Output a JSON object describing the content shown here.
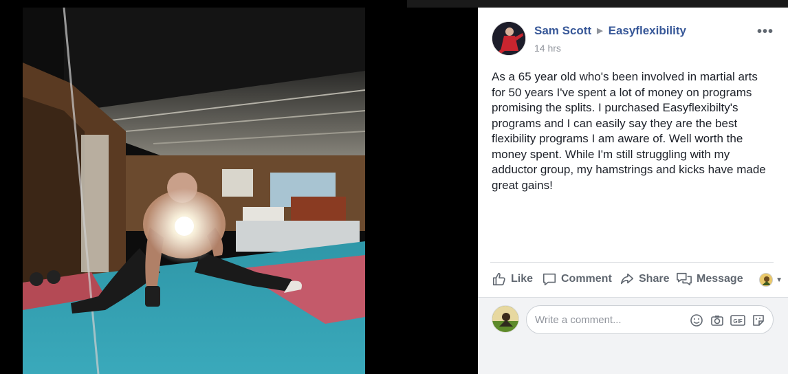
{
  "post": {
    "author": "Sam Scott",
    "target": "Easyflexibility",
    "time": "14 hrs",
    "more": "•••",
    "text": "As a 65 year old who's been involved in martial arts for 50 years I've spent a lot of money on programs promising the splits. I purchased Easyflexibilty's programs and I can easily say they are the best flexibility programs I am aware of. Well worth the money spent. While I'm still struggling with my adductor group, my hamstrings and kicks have made great gains!"
  },
  "actions": {
    "like": "Like",
    "comment": "Comment",
    "share": "Share",
    "message": "Message"
  },
  "comment_box": {
    "placeholder": "Write a comment..."
  },
  "colors": {
    "link": "#385898",
    "muted": "#90949c",
    "action_text": "#606770",
    "mat_teal": "#3a9fb0",
    "mat_red": "#c85a6a"
  },
  "icons": [
    "caret-right-icon",
    "more-icon",
    "like-icon",
    "comment-icon",
    "share-icon",
    "message-icon",
    "chevron-down-icon",
    "emoji-icon",
    "camera-icon",
    "gif-icon",
    "sticker-icon"
  ]
}
